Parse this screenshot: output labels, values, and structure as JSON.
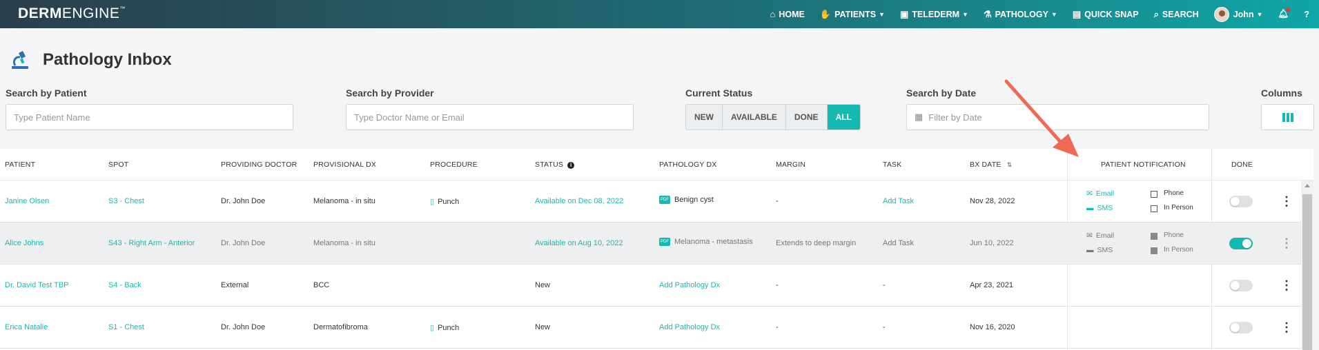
{
  "brand": {
    "part1": "DERM",
    "part2": "ENGINE",
    "tm": "™"
  },
  "nav": [
    {
      "label": "HOME",
      "icon": "home-icon",
      "caret": false
    },
    {
      "label": "PATIENTS",
      "icon": "patients-icon",
      "caret": true
    },
    {
      "label": "TELEDERM",
      "icon": "telederm-icon",
      "caret": true
    },
    {
      "label": "PATHOLOGY",
      "icon": "microscope-icon",
      "caret": true
    },
    {
      "label": "QUICK SNAP",
      "icon": "camera-icon",
      "caret": false
    },
    {
      "label": "SEARCH",
      "icon": "search-icon",
      "caret": false
    }
  ],
  "user": {
    "name": "John",
    "help": "?"
  },
  "page": {
    "title": "Pathology Inbox"
  },
  "filters": {
    "patient": {
      "label": "Search by Patient",
      "placeholder": "Type Patient Name"
    },
    "provider": {
      "label": "Search by Provider",
      "placeholder": "Type Doctor Name or Email"
    },
    "status": {
      "label": "Current Status",
      "options": [
        "NEW",
        "AVAILABLE",
        "DONE",
        "ALL"
      ],
      "selected": "ALL"
    },
    "date": {
      "label": "Search by Date",
      "placeholder": "Filter by Date"
    },
    "columns": {
      "label": "Columns"
    }
  },
  "table": {
    "headers": {
      "patient": "PATIENT",
      "spot": "SPOT",
      "doctor": "PROVIDING DOCTOR",
      "provisional": "PROVISIONAL DX",
      "procedure": "PROCEDURE",
      "status": "STATUS",
      "pathology": "PATHOLOGY DX",
      "margin": "MARGIN",
      "task": "TASK",
      "bxdate": "BX DATE",
      "notification": "PATIENT NOTIFICATION",
      "done": "DONE"
    },
    "rows": [
      {
        "patient": "Janine Olsen",
        "spot": "S3 - Chest",
        "doctor": "Dr. John Doe",
        "provisional": "Melanoma - in situ",
        "procedure": "Punch",
        "status": "Available on Dec 08, 2022",
        "pathology": "Benign cyst",
        "margin": "-",
        "task": "Add Task",
        "bxdate": "Nov 28, 2022",
        "notif": {
          "email": "Email",
          "sms": "SMS",
          "phone": "Phone",
          "inperson": "In Person"
        },
        "done": false
      },
      {
        "patient": "Alice Johns",
        "spot": "S43 - Right Arm - Anterior",
        "doctor": "Dr. John Doe",
        "provisional": "Melanoma - in situ",
        "procedure": "",
        "status": "Available on Aug 10, 2022",
        "pathology": "Melanoma - metastasis",
        "margin": "Extends to deep margin",
        "task": "Add Task",
        "bxdate": "Jun 10, 2022",
        "notif": {
          "email": "Email",
          "sms": "SMS",
          "phone": "Phone",
          "inperson": "In Person"
        },
        "done": true
      },
      {
        "patient": "Dr. David Test TBP",
        "spot": "S4 - Back",
        "doctor": "External",
        "provisional": "BCC",
        "procedure": "",
        "status": "New",
        "pathology": "Add Pathology Dx",
        "margin": "-",
        "task": "-",
        "bxdate": "Apr 23, 2021",
        "done": false
      },
      {
        "patient": "Erica Natalie",
        "spot": "S1 - Chest",
        "doctor": "Dr. John Doe",
        "provisional": "Dermatofibroma",
        "procedure": "Punch",
        "status": "New",
        "pathology": "Add Pathology Dx",
        "margin": "-",
        "task": "-",
        "bxdate": "Nov 16, 2020",
        "done": false
      }
    ]
  },
  "colors": {
    "accent": "#16b8b2",
    "annotation_arrow": "#ef6a55"
  }
}
